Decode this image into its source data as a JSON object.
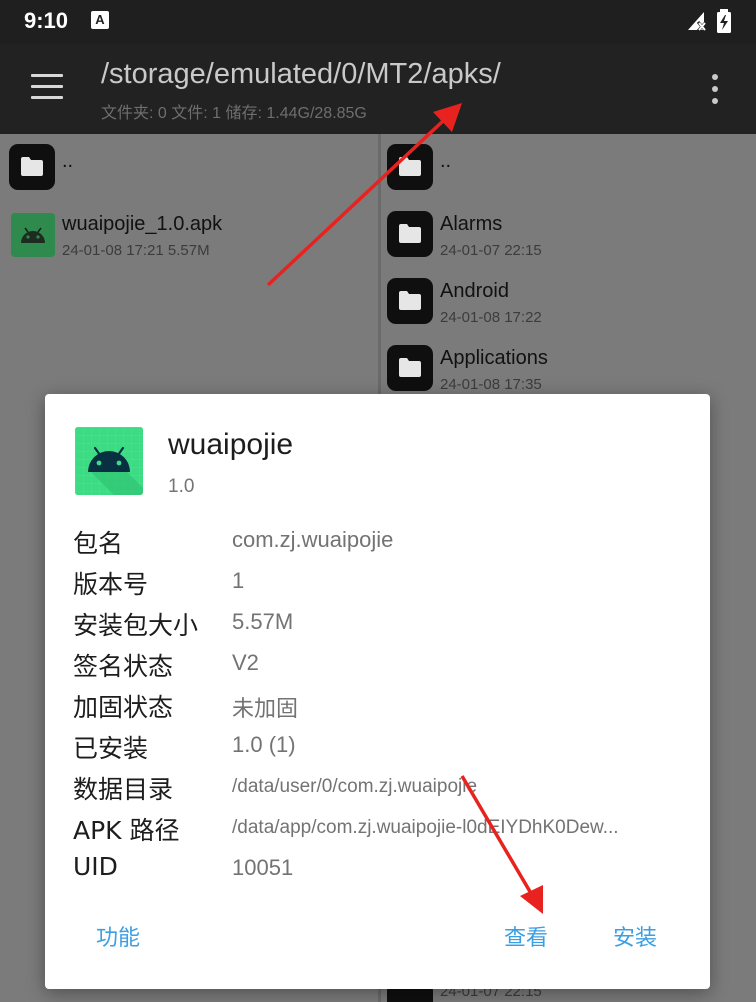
{
  "status_bar": {
    "time": "9:10",
    "notification_glyph": "A",
    "signal_icon": "signal-off-icon",
    "battery_icon": "battery-charging-icon"
  },
  "toolbar": {
    "path": "/storage/emulated/0/MT2/apks/",
    "summary": "文件夹: 0  文件: 1  储存: 1.44G/28.85G",
    "menu_icon": "hamburger-menu-icon",
    "more_icon": "more-vert-icon"
  },
  "left_pane": {
    "items": [
      {
        "name": "..",
        "meta": ""
      },
      {
        "name": "wuaipojie_1.0.apk",
        "meta": "24-01-08 17:21  5.57M"
      }
    ]
  },
  "right_pane": {
    "items": [
      {
        "name": "..",
        "meta": ""
      },
      {
        "name": "Alarms",
        "meta": "24-01-07 22:15"
      },
      {
        "name": "Android",
        "meta": "24-01-08 17:22"
      },
      {
        "name": "Applications",
        "meta": "24-01-08 17:35"
      }
    ],
    "bottom_meta_partial": "24-01-07 22:15"
  },
  "dialog": {
    "app_name": "wuaipojie",
    "app_version": "1.0",
    "info": [
      {
        "label": "包名",
        "value": "com.zj.wuaipojie"
      },
      {
        "label": "版本号",
        "value": "1"
      },
      {
        "label": "安装包大小",
        "value": "5.57M"
      },
      {
        "label": "签名状态",
        "value": "V2"
      },
      {
        "label": "加固状态",
        "value": "未加固"
      },
      {
        "label": "已安装",
        "value": "1.0 (1)"
      },
      {
        "label": "数据目录",
        "value": "/data/user/0/com.zj.wuaipojie"
      },
      {
        "label": "APK 路径",
        "value": "/data/app/com.zj.wuaipojie-l0dEIYDhK0Dew..."
      },
      {
        "label": "UID",
        "value": "10051"
      }
    ],
    "buttons": {
      "functions": "功能",
      "view": "查看",
      "install": "安装"
    }
  },
  "colors": {
    "accent": "#3b9fe3",
    "annotation": "#e8231f",
    "toolbar": "#222222",
    "android_green": "#3ddc84"
  }
}
